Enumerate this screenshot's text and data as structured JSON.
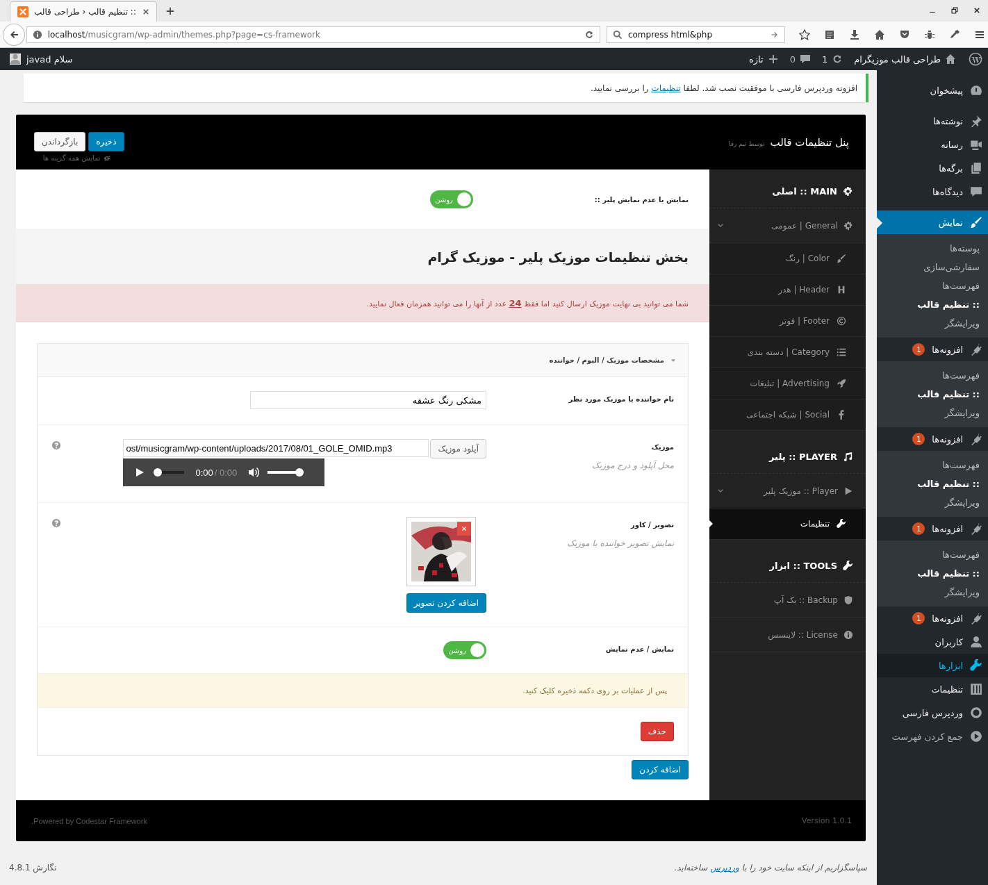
{
  "browser": {
    "tab_title": ":: تنظیم قالب ‹ طراحی قالب",
    "url_host": "localhost",
    "url_path": "/musicgram/wp-admin/themes.php?page=cs-framework",
    "search": "compress html&php"
  },
  "admin_bar": {
    "site_name": "طراحی قالب موزیگرام",
    "updates": "1",
    "comments": "0",
    "new": "تازه",
    "greeting": "سلام javad"
  },
  "notice": {
    "before": "افزونه وردپرس فارسی با موفقیت نصب شد. لطفا",
    "link": "تنظیمات",
    "after": "را بررسی نمایید."
  },
  "panel": {
    "title": "پنل تنظیمات قالب",
    "subtitle": "توسط تیم رقا",
    "save": "ذخیره",
    "reset": "بازگرداندن",
    "show_all": "نمایش همه گزینه ها",
    "nav": [
      {
        "kind": "heading",
        "label": "MAIN :: اصلی"
      },
      {
        "kind": "item",
        "label": "General | عمومی",
        "selected": false,
        "expanded": true,
        "children": [
          {
            "label": "Color | رنگ",
            "selected": false
          },
          {
            "label": "Header | هدر",
            "selected": false
          },
          {
            "label": "Footer | فوتر",
            "selected": false
          },
          {
            "label": "Category | دسته بندی",
            "selected": false
          },
          {
            "label": "Advertising | تبلیغات",
            "selected": false
          },
          {
            "label": "Social | شبکه اجتماعی",
            "selected": false
          }
        ]
      },
      {
        "kind": "heading",
        "label": "PLAYER :: پلیر"
      },
      {
        "kind": "item",
        "label": "Player :: موزیک پلیر",
        "selected": false,
        "expanded": true,
        "children": [
          {
            "label": "تنظیمات",
            "selected": true
          }
        ]
      },
      {
        "kind": "heading",
        "label": "TOOLS :: ابزار"
      },
      {
        "kind": "item",
        "label": "Backup :: بک آپ",
        "selected": false
      },
      {
        "kind": "item",
        "label": "License :: لاینسس",
        "selected": false
      }
    ],
    "content": {
      "toggle": {
        "label": "نمایش یا عدم نمایش پلیر ::",
        "on": true,
        "text": "روشن"
      },
      "heading": "بخش تنظیمات موزیک پلیر - موزیک گرام",
      "alert": "شما می توانید بی نهایت موزیک ارسال کنید اما فقط **24** عدد از آنها را می توانید همزمان فعال نمایید.",
      "group": {
        "title": "مشخصات موزیک / البوم / خواننده",
        "expanded": true,
        "fields": [
          {
            "kind": "text",
            "label": "نام خواننده یا موزیک مورد نظر",
            "value": "مشکی رنگ عشقه"
          },
          {
            "kind": "upload",
            "label": "موزیک",
            "description": "محل آپلود و درج موزیک",
            "value": "ost/musicgram/wp-content/uploads/2017/08/01_GOLE_OMID.mp3",
            "button": "آپلود موزیک",
            "help": true,
            "player": {
              "time": "0:00",
              "duration": "/ 0:00",
              "level": 0,
              "volume": {
                "level": 1
              }
            }
          },
          {
            "label": "تصویر / کاور",
            "description": "نمایش تصویر خواننده یا موزیک",
            "button": "اضافه کردن تصویر",
            "help": true
          },
          {
            "kind": "switch",
            "label": "نمایش / عدم نمایش",
            "on": true,
            "text": "روشن"
          },
          {
            "kind": "notice",
            "text": "پس از عملیات بر روی دکمه ذخیره کلیک کنید."
          },
          {
            "kind": "remove",
            "button": "حذف"
          }
        ]
      },
      "add": "اضافه کردن"
    },
    "powered": "Powered by Codestar Framework.",
    "version": "Version 1.0.1"
  },
  "footer": {
    "before": "سپاسگزاریم از اینکه سایت خود را با",
    "link": "وردپرس",
    "after": "ساخته‌اید.",
    "version": "نگارش 4.8.1"
  },
  "sidebar": [
    {
      "kind": "menu",
      "label": "پیشخوان",
      "selected": false
    },
    {
      "kind": "menu",
      "label": "نوشته‌ها",
      "selected": false
    },
    {
      "kind": "menu",
      "label": "رسانه",
      "selected": false
    },
    {
      "kind": "menu",
      "label": "برگه‌ها",
      "selected": false
    },
    {
      "kind": "menu",
      "label": "دیدگاه‌ها",
      "selected": false
    },
    {
      "kind": "menu",
      "label": "نمایش",
      "selected": true,
      "children": [
        {
          "label": "پوسته‌ها",
          "selected": false
        },
        {
          "label": "سفارشی‌سازی",
          "selected": false
        },
        {
          "label": "فهرست‌ها",
          "selected": false
        },
        {
          "label": ":: تنظیم قالب",
          "selected": true
        },
        {
          "label": "ویرایشگر",
          "selected": false
        }
      ]
    },
    {
      "kind": "menu",
      "label": "افزونه‌ها",
      "badge": "1",
      "selected": false,
      "children": [
        {
          "label": "فهرست‌ها",
          "selected": false
        },
        {
          "label": ":: تنظیم قالب",
          "selected": true
        },
        {
          "label": "ویرایشگر",
          "selected": false
        }
      ]
    },
    {
      "kind": "menu",
      "label": "افزونه‌ها",
      "badge": "1",
      "selected": false,
      "children": [
        {
          "label": "فهرست‌ها",
          "selected": false
        },
        {
          "label": ":: تنظیم قالب",
          "selected": true
        },
        {
          "label": "ویرایشگر",
          "selected": false
        }
      ]
    },
    {
      "kind": "menu",
      "label": "افزونه‌ها",
      "badge": "1",
      "selected": false,
      "children": [
        {
          "label": "فهرست‌ها",
          "selected": false
        },
        {
          "label": ":: تنظیم قالب",
          "selected": true
        },
        {
          "label": "ویرایشگر",
          "selected": false
        }
      ]
    },
    {
      "kind": "menu",
      "label": "افزونه‌ها",
      "badge": "1",
      "selected": false
    },
    {
      "kind": "menu",
      "label": "کاربران",
      "selected": false
    },
    {
      "kind": "menu",
      "label": "ابزارها",
      "selected": false,
      "hover": true
    },
    {
      "kind": "menu",
      "label": "تنظیمات",
      "selected": false
    },
    {
      "kind": "menu",
      "label": "وردپرس فارسی",
      "selected": false
    },
    {
      "kind": "collapse",
      "label": "جمع کردن فهرست",
      "selected": false
    }
  ]
}
